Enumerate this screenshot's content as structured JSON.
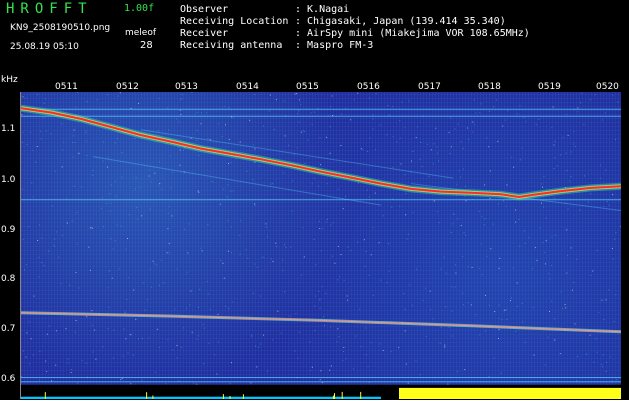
{
  "header": {
    "app_title": "HROFFT",
    "version": "1.00f",
    "filename": "KN9_2508190510.png",
    "datetime": "25.08.19 05:10",
    "meleof_label": "meleof",
    "meleof_value": "28"
  },
  "info": [
    {
      "label": "Observer",
      "value": ": K.Nagai"
    },
    {
      "label": "Receiving Location",
      "value": ": Chigasaki, Japan (139.414 35.340)"
    },
    {
      "label": "Receiver",
      "value": ": AirSpy mini (Miakejima VOR 108.65MHz)"
    },
    {
      "label": "Receiving antenna",
      "value": ": Maspro FM-3"
    }
  ],
  "chart_data": {
    "type": "heatmap",
    "yunit": "kHz",
    "y_ticks": [
      "1.1",
      "1.0",
      "0.9",
      "0.8",
      "0.7",
      "0.6"
    ],
    "time_ticks": [
      "0511",
      "0512",
      "0513",
      "0514",
      "0515",
      "0516",
      "0517",
      "0518",
      "0519",
      "0520"
    ],
    "ylim": [
      0.58,
      1.15
    ],
    "xlim": [
      0,
      10
    ],
    "colors": {
      "background": "#1f2ea0",
      "trace": "#ff2a2a",
      "faint_line": "#5ad8ff",
      "signal_bar": "#ffff1a",
      "noise_bar": "#00c8ff"
    },
    "main_trace": [
      {
        "x": 0.0,
        "y": 1.12
      },
      {
        "x": 0.5,
        "y": 1.112
      },
      {
        "x": 1.0,
        "y": 1.1
      },
      {
        "x": 1.5,
        "y": 1.085
      },
      {
        "x": 2.0,
        "y": 1.07
      },
      {
        "x": 2.5,
        "y": 1.058
      },
      {
        "x": 3.0,
        "y": 1.045
      },
      {
        "x": 3.5,
        "y": 1.035
      },
      {
        "x": 4.0,
        "y": 1.025
      },
      {
        "x": 4.5,
        "y": 1.014
      },
      {
        "x": 5.0,
        "y": 1.002
      },
      {
        "x": 5.5,
        "y": 0.991
      },
      {
        "x": 6.0,
        "y": 0.98
      },
      {
        "x": 6.5,
        "y": 0.97
      },
      {
        "x": 7.0,
        "y": 0.965
      },
      {
        "x": 7.5,
        "y": 0.963
      },
      {
        "x": 8.0,
        "y": 0.96
      },
      {
        "x": 8.3,
        "y": 0.955
      },
      {
        "x": 8.6,
        "y": 0.96
      },
      {
        "x": 9.0,
        "y": 0.966
      },
      {
        "x": 9.5,
        "y": 0.972
      },
      {
        "x": 10.0,
        "y": 0.975
      }
    ],
    "secondary_trace": [
      {
        "x": 0.0,
        "y": 0.74
      },
      {
        "x": 2.5,
        "y": 0.734
      },
      {
        "x": 5.0,
        "y": 0.726
      },
      {
        "x": 7.5,
        "y": 0.716
      },
      {
        "x": 10.0,
        "y": 0.705
      }
    ],
    "horizontal_lines": [
      1.118,
      1.105,
      0.95,
      0.62,
      0.612
    ],
    "faint_diagonals": [
      [
        {
          "x": 1.2,
          "y": 1.03
        },
        {
          "x": 6.0,
          "y": 0.94
        }
      ],
      [
        {
          "x": 2.0,
          "y": 1.08
        },
        {
          "x": 7.2,
          "y": 0.99
        }
      ],
      [
        {
          "x": 6.5,
          "y": 0.98
        },
        {
          "x": 10.0,
          "y": 0.93
        }
      ]
    ],
    "signal_bar": {
      "x_start": 6.3,
      "x_end": 10.0,
      "level": 0.78
    },
    "noise_bar": {
      "x_start": 0.0,
      "x_end": 6.0,
      "level": 0.16
    }
  }
}
